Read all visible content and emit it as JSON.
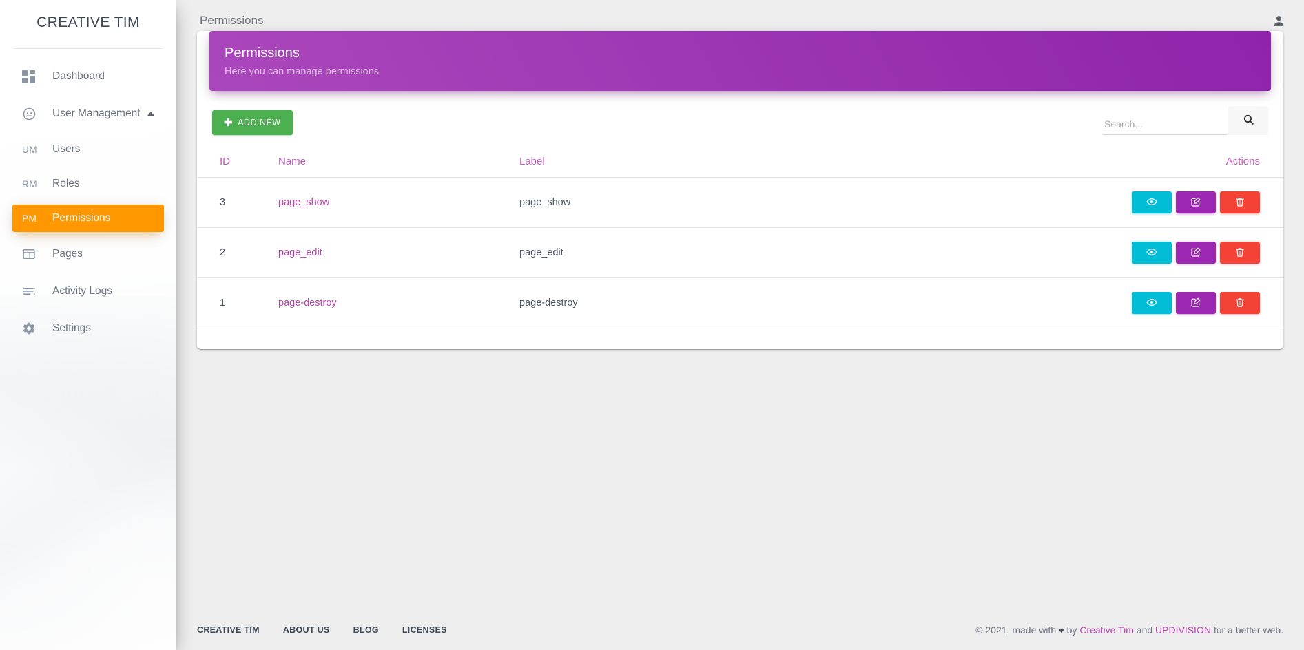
{
  "sidebar": {
    "brand": "CREATIVE TIM",
    "items": [
      {
        "label": "Dashboard",
        "icon": "dashboard-grid-icon",
        "type": "main",
        "active": false
      },
      {
        "label": "User Management",
        "icon": "user-circle-icon",
        "type": "main",
        "active": false,
        "expanded": true,
        "caret": "chevron-up-icon"
      },
      {
        "label": "Users",
        "mini": "UM",
        "type": "sub",
        "active": false
      },
      {
        "label": "Roles",
        "mini": "RM",
        "type": "sub",
        "active": false
      },
      {
        "label": "Permissions",
        "mini": "PM",
        "type": "sub",
        "active": true
      },
      {
        "label": "Pages",
        "icon": "pages-layout-icon",
        "type": "main",
        "active": false
      },
      {
        "label": "Activity Logs",
        "icon": "list-lines-icon",
        "type": "main",
        "active": false
      },
      {
        "label": "Settings",
        "icon": "gear-icon",
        "type": "main",
        "active": false
      }
    ]
  },
  "topbar": {
    "title": "Permissions",
    "user_icon": "user-account-icon"
  },
  "card": {
    "title": "Permissions",
    "subtitle": "Here you can manage permissions",
    "add_button": "ADD NEW",
    "add_icon": "plus-icon",
    "search": {
      "placeholder": "Search...",
      "value": "",
      "button_icon": "search-icon"
    }
  },
  "table": {
    "columns": [
      "ID",
      "Name",
      "Label",
      "Actions"
    ],
    "rows": [
      {
        "id": "3",
        "name": "page_show",
        "label": "page_show"
      },
      {
        "id": "2",
        "name": "page_edit",
        "label": "page_edit"
      },
      {
        "id": "1",
        "name": "page-destroy",
        "label": "page-destroy"
      }
    ],
    "actions": [
      {
        "name": "view",
        "icon": "eye-icon",
        "color": "#00bcd4"
      },
      {
        "name": "edit",
        "icon": "pencil-square-icon",
        "color": "#9c27b0"
      },
      {
        "name": "delete",
        "icon": "trash-icon",
        "color": "#f44336"
      }
    ]
  },
  "footer": {
    "links": [
      "CREATIVE TIM",
      "ABOUT US",
      "BLOG",
      "LICENSES"
    ],
    "copyright_prefix": "© 2021, made with ",
    "heart": "♥",
    "copyright_by": " by ",
    "brand1": "Creative Tim",
    "copyright_and": " and ",
    "brand2": "UPDIVISION",
    "copyright_suffix": " for a better web."
  },
  "colors": {
    "accent_purple": "#9c27b0",
    "accent_orange": "#ff9800",
    "accent_green": "#4caf50",
    "accent_cyan": "#00bcd4",
    "accent_red": "#f44336",
    "link_pink": "#b845ae",
    "page_bg": "#eeeeee"
  }
}
